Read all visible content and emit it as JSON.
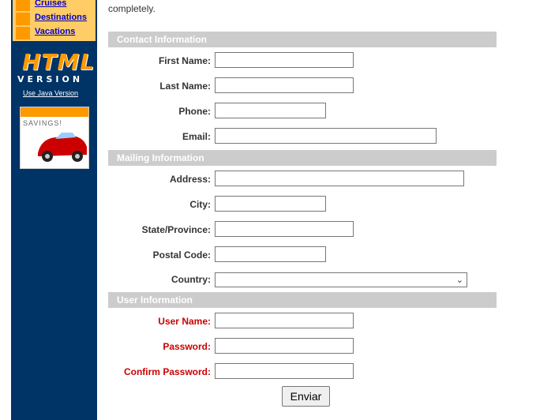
{
  "nav": {
    "items": [
      {
        "label": "Cruises"
      },
      {
        "label": "Destinations"
      },
      {
        "label": "Vacations"
      }
    ]
  },
  "logo": {
    "html_text": "HTML",
    "version_text": "VERSION",
    "java_link": "Use Java Version"
  },
  "ad": {
    "label": "SAVINGS!"
  },
  "intro_text": "completely.",
  "sections": {
    "contact": "Contact Information",
    "mailing": "Mailing Information",
    "user": "User Information"
  },
  "fields": {
    "first_name": {
      "label": "First Name:",
      "value": ""
    },
    "last_name": {
      "label": "Last Name:",
      "value": ""
    },
    "phone": {
      "label": "Phone:",
      "value": ""
    },
    "email": {
      "label": "Email:",
      "value": ""
    },
    "address": {
      "label": "Address:",
      "value": ""
    },
    "city": {
      "label": "City:",
      "value": ""
    },
    "state": {
      "label": "State/Province:",
      "value": ""
    },
    "postal": {
      "label": "Postal Code:",
      "value": ""
    },
    "country": {
      "label": "Country:",
      "value": ""
    },
    "username": {
      "label": "User Name:",
      "value": ""
    },
    "password": {
      "label": "Password:",
      "value": ""
    },
    "confirm_password": {
      "label": "Confirm Password:",
      "value": ""
    }
  },
  "submit_label": "Enviar",
  "colors": {
    "sidebar": "#003366",
    "nav_bg": "#ffcc66",
    "accent": "#ff9900",
    "section_bg": "#cccccc",
    "required_label": "#cc0000",
    "link": "#0000cc"
  }
}
